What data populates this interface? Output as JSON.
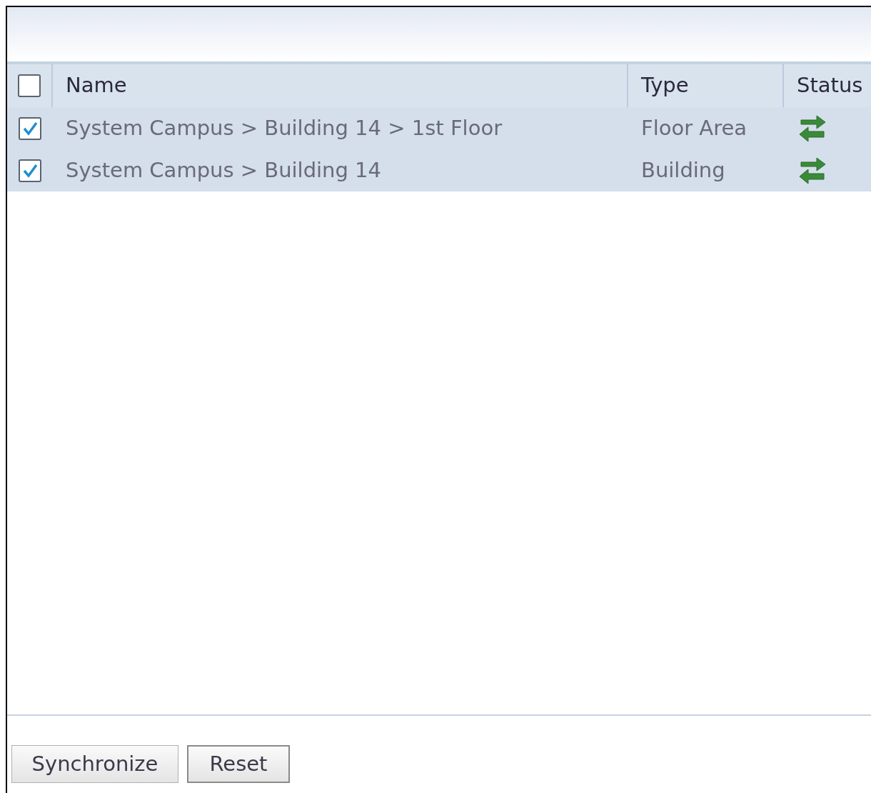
{
  "table": {
    "select_all_checked": false,
    "columns": [
      "Name",
      "Type",
      "Status"
    ],
    "rows": [
      {
        "name": "System Campus > Building 14 > 1st Floor",
        "type": "Floor Area",
        "checked": true
      },
      {
        "name": "System Campus > Building 14",
        "type": "Building",
        "checked": true
      }
    ]
  },
  "buttons": [
    "Synchronize",
    "Reset"
  ]
}
